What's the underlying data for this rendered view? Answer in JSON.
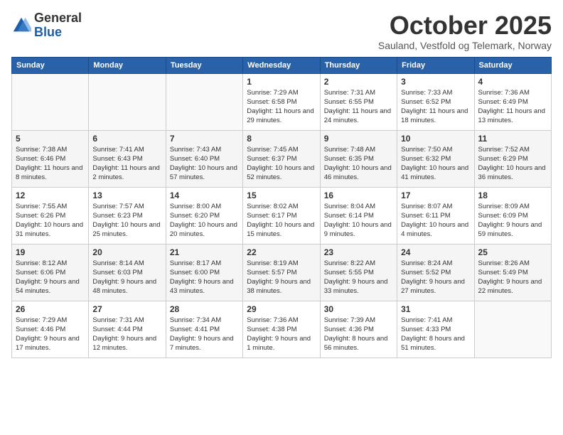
{
  "logo": {
    "general": "General",
    "blue": "Blue"
  },
  "header": {
    "month": "October 2025",
    "subtitle": "Sauland, Vestfold og Telemark, Norway"
  },
  "days_of_week": [
    "Sunday",
    "Monday",
    "Tuesday",
    "Wednesday",
    "Thursday",
    "Friday",
    "Saturday"
  ],
  "weeks": [
    [
      {
        "day": "",
        "info": ""
      },
      {
        "day": "",
        "info": ""
      },
      {
        "day": "",
        "info": ""
      },
      {
        "day": "1",
        "info": "Sunrise: 7:29 AM\nSunset: 6:58 PM\nDaylight: 11 hours and 29 minutes."
      },
      {
        "day": "2",
        "info": "Sunrise: 7:31 AM\nSunset: 6:55 PM\nDaylight: 11 hours and 24 minutes."
      },
      {
        "day": "3",
        "info": "Sunrise: 7:33 AM\nSunset: 6:52 PM\nDaylight: 11 hours and 18 minutes."
      },
      {
        "day": "4",
        "info": "Sunrise: 7:36 AM\nSunset: 6:49 PM\nDaylight: 11 hours and 13 minutes."
      }
    ],
    [
      {
        "day": "5",
        "info": "Sunrise: 7:38 AM\nSunset: 6:46 PM\nDaylight: 11 hours and 8 minutes."
      },
      {
        "day": "6",
        "info": "Sunrise: 7:41 AM\nSunset: 6:43 PM\nDaylight: 11 hours and 2 minutes."
      },
      {
        "day": "7",
        "info": "Sunrise: 7:43 AM\nSunset: 6:40 PM\nDaylight: 10 hours and 57 minutes."
      },
      {
        "day": "8",
        "info": "Sunrise: 7:45 AM\nSunset: 6:37 PM\nDaylight: 10 hours and 52 minutes."
      },
      {
        "day": "9",
        "info": "Sunrise: 7:48 AM\nSunset: 6:35 PM\nDaylight: 10 hours and 46 minutes."
      },
      {
        "day": "10",
        "info": "Sunrise: 7:50 AM\nSunset: 6:32 PM\nDaylight: 10 hours and 41 minutes."
      },
      {
        "day": "11",
        "info": "Sunrise: 7:52 AM\nSunset: 6:29 PM\nDaylight: 10 hours and 36 minutes."
      }
    ],
    [
      {
        "day": "12",
        "info": "Sunrise: 7:55 AM\nSunset: 6:26 PM\nDaylight: 10 hours and 31 minutes."
      },
      {
        "day": "13",
        "info": "Sunrise: 7:57 AM\nSunset: 6:23 PM\nDaylight: 10 hours and 25 minutes."
      },
      {
        "day": "14",
        "info": "Sunrise: 8:00 AM\nSunset: 6:20 PM\nDaylight: 10 hours and 20 minutes."
      },
      {
        "day": "15",
        "info": "Sunrise: 8:02 AM\nSunset: 6:17 PM\nDaylight: 10 hours and 15 minutes."
      },
      {
        "day": "16",
        "info": "Sunrise: 8:04 AM\nSunset: 6:14 PM\nDaylight: 10 hours and 9 minutes."
      },
      {
        "day": "17",
        "info": "Sunrise: 8:07 AM\nSunset: 6:11 PM\nDaylight: 10 hours and 4 minutes."
      },
      {
        "day": "18",
        "info": "Sunrise: 8:09 AM\nSunset: 6:09 PM\nDaylight: 9 hours and 59 minutes."
      }
    ],
    [
      {
        "day": "19",
        "info": "Sunrise: 8:12 AM\nSunset: 6:06 PM\nDaylight: 9 hours and 54 minutes."
      },
      {
        "day": "20",
        "info": "Sunrise: 8:14 AM\nSunset: 6:03 PM\nDaylight: 9 hours and 48 minutes."
      },
      {
        "day": "21",
        "info": "Sunrise: 8:17 AM\nSunset: 6:00 PM\nDaylight: 9 hours and 43 minutes."
      },
      {
        "day": "22",
        "info": "Sunrise: 8:19 AM\nSunset: 5:57 PM\nDaylight: 9 hours and 38 minutes."
      },
      {
        "day": "23",
        "info": "Sunrise: 8:22 AM\nSunset: 5:55 PM\nDaylight: 9 hours and 33 minutes."
      },
      {
        "day": "24",
        "info": "Sunrise: 8:24 AM\nSunset: 5:52 PM\nDaylight: 9 hours and 27 minutes."
      },
      {
        "day": "25",
        "info": "Sunrise: 8:26 AM\nSunset: 5:49 PM\nDaylight: 9 hours and 22 minutes."
      }
    ],
    [
      {
        "day": "26",
        "info": "Sunrise: 7:29 AM\nSunset: 4:46 PM\nDaylight: 9 hours and 17 minutes."
      },
      {
        "day": "27",
        "info": "Sunrise: 7:31 AM\nSunset: 4:44 PM\nDaylight: 9 hours and 12 minutes."
      },
      {
        "day": "28",
        "info": "Sunrise: 7:34 AM\nSunset: 4:41 PM\nDaylight: 9 hours and 7 minutes."
      },
      {
        "day": "29",
        "info": "Sunrise: 7:36 AM\nSunset: 4:38 PM\nDaylight: 9 hours and 1 minute."
      },
      {
        "day": "30",
        "info": "Sunrise: 7:39 AM\nSunset: 4:36 PM\nDaylight: 8 hours and 56 minutes."
      },
      {
        "day": "31",
        "info": "Sunrise: 7:41 AM\nSunset: 4:33 PM\nDaylight: 8 hours and 51 minutes."
      },
      {
        "day": "",
        "info": ""
      }
    ]
  ]
}
